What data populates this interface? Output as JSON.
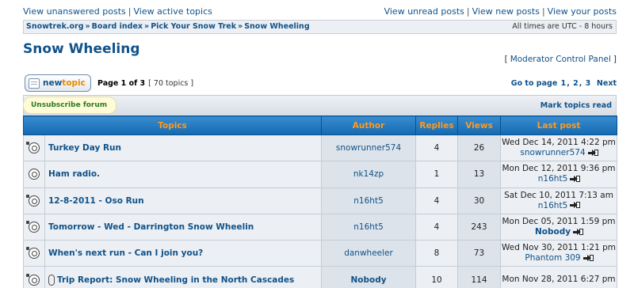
{
  "top": {
    "unanswered": "View unanswered posts",
    "active": "View active topics",
    "unread": "View unread posts",
    "new": "View new posts",
    "your": "View your posts",
    "sep": "|"
  },
  "breadcrumb": {
    "items": [
      "Snowtrek.org",
      "Board index",
      "Pick Your Snow Trek",
      "Snow Wheeling"
    ],
    "arrow": "»",
    "timezone": "All times are UTC - 8 hours"
  },
  "forum": {
    "title": "Snow Wheeling",
    "mod_panel": "Moderator Control Panel",
    "lb": "[",
    "rb": "]"
  },
  "toolbar": {
    "new_label": "new",
    "topic_label": "topic",
    "page_info": "Page 1 of 3",
    "topic_count": "[ 70 topics ]",
    "goto": "Go to page",
    "pages": [
      "1",
      "2",
      "3"
    ],
    "next": "Next",
    "unsubscribe": "Unsubscribe forum",
    "mark_read": "Mark topics read"
  },
  "table": {
    "headers": {
      "topics": "Topics",
      "author": "Author",
      "replies": "Replies",
      "views": "Views",
      "last": "Last post"
    },
    "rows": [
      {
        "title": "Turkey Day Run",
        "author": "snowrunner574",
        "replies": "4",
        "views": "26",
        "last_date": "Wed Dec 14, 2011 4:22 pm",
        "last_user": "snowrunner574",
        "hot": true,
        "attach": false
      },
      {
        "title": "Ham radio.",
        "author": "nk14zp",
        "replies": "1",
        "views": "13",
        "last_date": "Mon Dec 12, 2011 9:36 pm",
        "last_user": "n16ht5",
        "hot": false,
        "attach": false
      },
      {
        "title": "12-8-2011 - Oso Run",
        "author": "n16ht5",
        "replies": "4",
        "views": "30",
        "last_date": "Sat Dec 10, 2011 7:13 am",
        "last_user": "n16ht5",
        "hot": true,
        "attach": false
      },
      {
        "title": "Tomorrow - Wed - Darrington Snow Wheelin",
        "author": "n16ht5",
        "replies": "4",
        "views": "243",
        "last_date": "Mon Dec 05, 2011 1:59 pm",
        "last_user": "Nobody",
        "hot": true,
        "attach": false
      },
      {
        "title": "When's next run - Can I join you?",
        "author": "danwheeler",
        "replies": "8",
        "views": "73",
        "last_date": "Wed Nov 30, 2011 1:21 pm",
        "last_user": "Phantom 309",
        "hot": true,
        "attach": false
      },
      {
        "title": "Trip Report: Snow Wheeling in the North Cascades",
        "author": "Nobody",
        "replies": "10",
        "views": "114",
        "last_date": "Mon Nov 28, 2011 6:27 pm",
        "last_user": "",
        "hot": true,
        "attach": true
      }
    ]
  }
}
